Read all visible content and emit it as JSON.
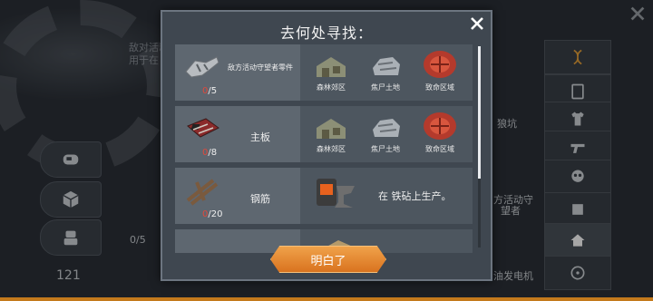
{
  "background": {
    "left_text_line1": "敌对活动据",
    "left_text_line2": "用于在 包围",
    "right_label_1": "狼坑",
    "right_label_2": "方活动守",
    "right_label_3": "望者",
    "right_label_4": "油发电机",
    "left_count": "0/5",
    "level_number": "121"
  },
  "dialog": {
    "title": "去何处寻找：",
    "ok_label": "明白了",
    "items": [
      {
        "name": "敌方活动守望者零件",
        "have": "0",
        "need": "/5",
        "icon": "mech-parts-icon",
        "locations": [
          {
            "label": "森林郊区",
            "icon": "forest-suburb-icon"
          },
          {
            "label": "焦尸土地",
            "icon": "burnt-land-icon"
          },
          {
            "label": "致命区域",
            "icon": "deadly-zone-icon"
          }
        ]
      },
      {
        "name": "主板",
        "have": "0",
        "need": "/8",
        "icon": "motherboard-icon",
        "locations": [
          {
            "label": "森林郊区",
            "icon": "forest-suburb-icon"
          },
          {
            "label": "焦尸土地",
            "icon": "burnt-land-icon"
          },
          {
            "label": "致命区域",
            "icon": "deadly-zone-icon"
          }
        ]
      },
      {
        "name": "钢筋",
        "have": "0",
        "need": "/20",
        "icon": "rebar-icon",
        "produce_text": "在 铁砧上生产。",
        "produce_icon": "anvil-icon"
      }
    ]
  },
  "colors": {
    "accent": "#d9731f",
    "need_red": "#e0493c",
    "dialog_bg": "#3f4750"
  }
}
